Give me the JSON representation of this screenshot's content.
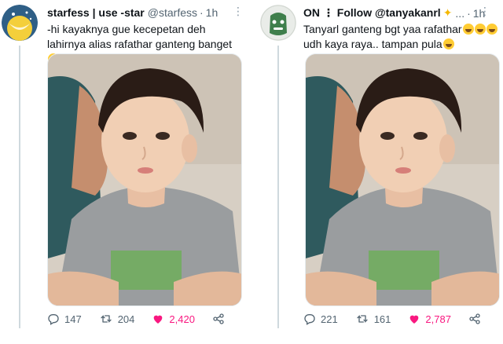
{
  "tweets": [
    {
      "display_name": "starfess | use -star",
      "handle": "@starfess",
      "time": "1h",
      "text": "-hi kayaknya gue kecepetan deh lahirnya alias rafathar ganteng banget",
      "replies": "147",
      "retweets": "204",
      "likes": "2,420",
      "liked": true
    },
    {
      "display_name": "ON ⋮ Follow @tanyakanrl",
      "handle": "...",
      "time": "1h",
      "text_line1": "Tanyarl ganteng bgt yaa rafathar",
      "text_line2": "udh kaya raya.. tampan pula",
      "replies": "221",
      "retweets": "161",
      "likes": "2,787",
      "liked": true
    }
  ],
  "colors": {
    "like": "#f91880",
    "muted": "#536471",
    "text": "#0f1419",
    "avatar_left_bg": "#f4cf3b",
    "avatar_right_bg": "#9ed39b"
  },
  "icons": [
    "reply-icon",
    "retweet-icon",
    "heart-icon",
    "share-icon",
    "more-icon",
    "verified-sparkle-icon"
  ]
}
